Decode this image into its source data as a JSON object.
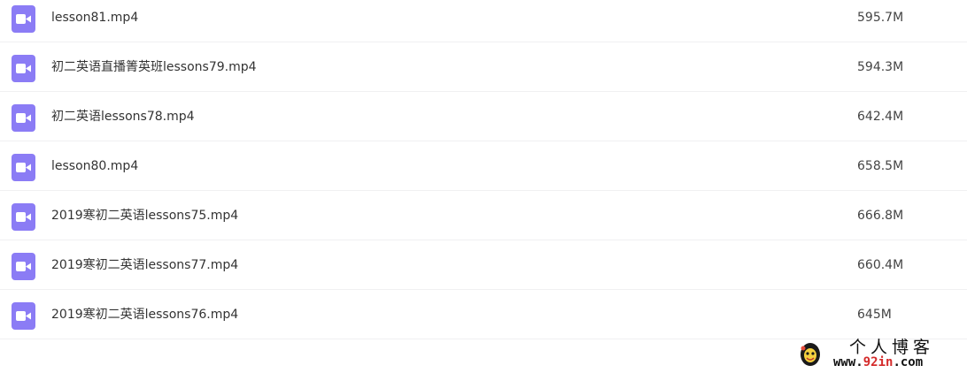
{
  "files": [
    {
      "name": "lesson81.mp4",
      "size": "595.7M",
      "icon": "video-file-icon"
    },
    {
      "name": "初二英语直播箐英班lessons79.mp4",
      "size": "594.3M",
      "icon": "video-file-icon"
    },
    {
      "name": "初二英语lessons78.mp4",
      "size": "642.4M",
      "icon": "video-file-icon"
    },
    {
      "name": "lesson80.mp4",
      "size": "658.5M",
      "icon": "video-file-icon"
    },
    {
      "name": "2019寒初二英语lessons75.mp4",
      "size": "666.8M",
      "icon": "video-file-icon"
    },
    {
      "name": "2019寒初二英语lessons77.mp4",
      "size": "660.4M",
      "icon": "video-file-icon"
    },
    {
      "name": "2019寒初二英语lessons76.mp4",
      "size": "645M",
      "icon": "video-file-icon"
    }
  ],
  "watermark": {
    "title": "个人博客",
    "url_prefix": "www.",
    "url_highlight": "92in",
    "url_suffix": ".com"
  },
  "colors": {
    "icon_background": "#8b7cf5",
    "row_divider": "#f0f0f2",
    "url_highlight": "#d42a2a"
  }
}
